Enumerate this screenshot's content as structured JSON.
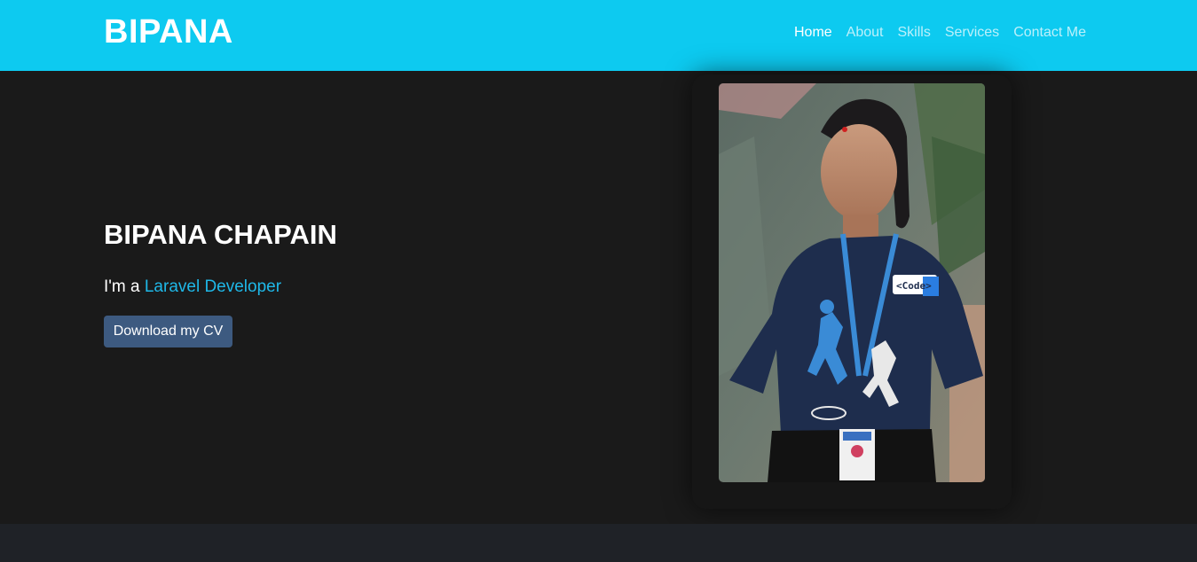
{
  "nav": {
    "brand": "BIPANA",
    "links": [
      {
        "label": "Home",
        "active": true
      },
      {
        "label": "About",
        "active": false
      },
      {
        "label": "Skills",
        "active": false
      },
      {
        "label": "Services",
        "active": false
      },
      {
        "label": "Contact Me",
        "active": false
      }
    ]
  },
  "hero": {
    "name": "BIPANA CHAPAIN",
    "tagline_prefix": "I'm a ",
    "tagline_role": "Laravel Developer",
    "cv_button": "Download my CV",
    "photo_badge_text": "<Code>"
  },
  "colors": {
    "navbar": "#0dcaf0",
    "background": "#1a1a1a",
    "accent_text": "#1fb8e8",
    "button": "#3d5a80",
    "footer_band": "#1f2227"
  }
}
